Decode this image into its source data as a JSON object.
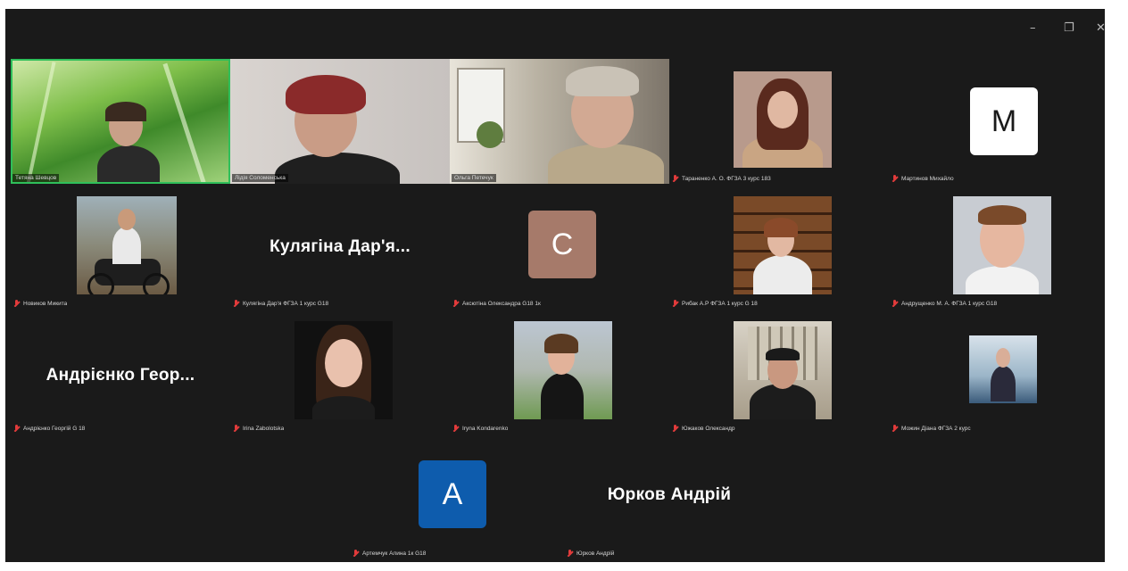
{
  "window_controls": {
    "minimize_icon": "minimize-icon",
    "restore_icon": "restore-icon",
    "close_icon": "close-icon"
  },
  "colors": {
    "background": "#1a1a1a",
    "active_speaker_border": "#2fbf5a",
    "muted_mic": "#e23b3b",
    "avatar_m": "#ffffff",
    "avatar_c": "#a67a6a",
    "avatar_a": "#0e5cad"
  },
  "participants": [
    {
      "label": "Тетяна Шевцов",
      "tile_type": "video",
      "muted": false,
      "active_speaker": true
    },
    {
      "label": "Лідія Соломенська",
      "tile_type": "video",
      "muted": false
    },
    {
      "label": "Ольга Петечук",
      "tile_type": "video",
      "muted": false
    },
    {
      "label": "Тараненко А. О. ФГЗА 3 курс 183",
      "tile_type": "photo",
      "muted": true
    },
    {
      "label": "Мартинов Михайло",
      "tile_type": "letter",
      "avatar_letter": "M",
      "muted": true
    },
    {
      "label": "Новиков Микита",
      "tile_type": "photo",
      "muted": true
    },
    {
      "label": "Кулягіна Дар'я ФГЗА 1 курс G18",
      "tile_type": "name",
      "display_name": "Кулягіна Дар'я...",
      "muted": true
    },
    {
      "label": "Аксютіна Олександра G18 1к",
      "tile_type": "letter",
      "avatar_letter": "C",
      "muted": true
    },
    {
      "label": "Рибак А.Р ФГЗА 1 курс G 18",
      "tile_type": "photo",
      "muted": true
    },
    {
      "label": "Андрущенко М. А. ФГЗА 1 курс G18",
      "tile_type": "photo",
      "muted": true
    },
    {
      "label": "Андрієнко Георгій G 18",
      "tile_type": "name",
      "display_name": "Андрієнко Геор...",
      "muted": true
    },
    {
      "label": "Irina Zabolotska",
      "tile_type": "photo",
      "muted": true
    },
    {
      "label": "Iryna Kondarenko",
      "tile_type": "photo",
      "muted": true
    },
    {
      "label": "Южаков Олександр",
      "tile_type": "photo",
      "muted": true
    },
    {
      "label": "Можин Діана ФГЗА 2 курс",
      "tile_type": "photo",
      "muted": true
    },
    {
      "label": "Артемчук Алина 1к G18",
      "tile_type": "letter",
      "avatar_letter": "A",
      "muted": true
    },
    {
      "label": "Юрков Андрій",
      "tile_type": "name",
      "display_name": "Юрков Андрій",
      "muted": true
    }
  ]
}
